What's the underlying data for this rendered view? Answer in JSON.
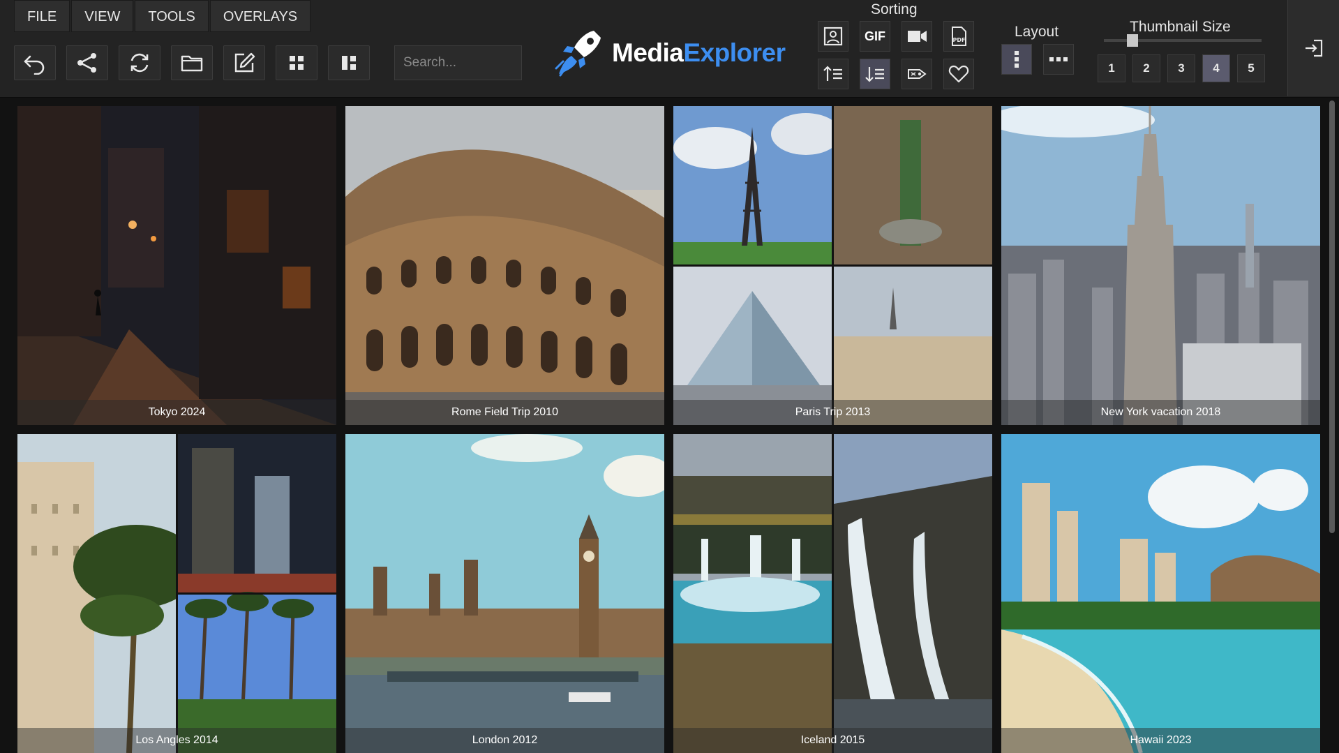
{
  "menu": [
    "FILE",
    "VIEW",
    "TOOLS",
    "OVERLAYS"
  ],
  "toolbar": {
    "buttons": [
      "undo-icon",
      "share-icon",
      "refresh-icon",
      "folder-icon",
      "edit-icon",
      "grid-icon",
      "mosaic-icon"
    ],
    "search_placeholder": "Search..."
  },
  "logo": {
    "part1": "Media",
    "part2": "Explorer"
  },
  "sorting": {
    "title": "Sorting",
    "gif_label": "GIF",
    "buttons_row1": [
      "image-icon",
      "gif-icon",
      "video-icon",
      "pdf-icon"
    ],
    "buttons_row2": [
      "sort-ascending-icon",
      "sort-descending-icon",
      "tag-icon",
      "heart-icon"
    ],
    "active": "sort-descending-icon"
  },
  "layout": {
    "title": "Layout",
    "options": [
      "vertical-dots-icon",
      "horizontal-dots-icon"
    ],
    "active": "vertical-dots-icon"
  },
  "thumbnail_size": {
    "title": "Thumbnail Size",
    "sizes": [
      "1",
      "2",
      "3",
      "4",
      "5"
    ],
    "selected": "4",
    "slider_level": 0.18
  },
  "albums": [
    "Tokyo 2024",
    "Rome Field Trip 2010",
    "Paris Trip 2013",
    "New York vacation 2018",
    "Los Angles 2014",
    "London 2012",
    "Iceland 2015",
    "Hawaii 2023"
  ],
  "colors": {
    "accent": "#3d8ef0",
    "background": "#121212",
    "toolbar": "#232323"
  }
}
